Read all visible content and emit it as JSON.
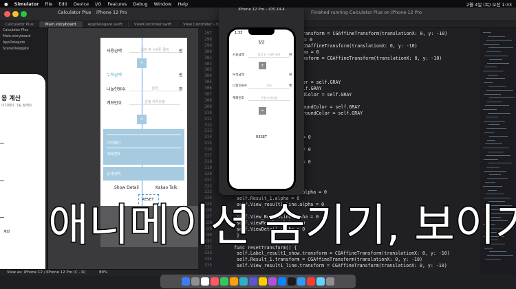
{
  "menubar": {
    "apple": "",
    "app": "Simulator",
    "items": [
      "File",
      "Edit",
      "Device",
      "I/O",
      "Features",
      "Debug",
      "Window",
      "Help"
    ],
    "status": "2월 4일 (목) 오전 1:33"
  },
  "xcode": {
    "scheme": "Calculator Plus",
    "device": "iPhone 12 Pro",
    "status": "Finished running Calculator Plus on iPhone 12 Pro",
    "tabs": [
      "Calculator Plus",
      "Main.storyboard",
      "AppDelegate.swift",
      "ViewController.swift"
    ],
    "breadcrumb": "View Controller › View › Button-RESET",
    "view_as": "View as: iPhone 12 / iPhone 12 Pro (C - R)",
    "zoom": "89%"
  },
  "navigator": {
    "rows": [
      "Calculator Plus",
      "Main.storyboard",
      "AppDelegate",
      "SceneDelegate"
    ],
    "sim_title": "용 계산",
    "sim_sub": "더치페이 그림 팔레트",
    "sim_labels": [
      "",
      "",
      "계좌"
    ]
  },
  "storyboard": {
    "labels": [
      "사용금액",
      "누적금액",
      "나눌인원수",
      "계좌번호"
    ],
    "fields": [
      "입력 후 +버튼 클릭",
      "",
      "입력",
      "은행 카카오뱅"
    ],
    "units": [
      "원",
      "원",
      "명",
      ""
    ],
    "tile_top": "+",
    "tile_mid": "=",
    "panel1": [
      "더치페이",
      "계좌번호"
    ],
    "panel2": "상세내역",
    "buttons": [
      "Show Detail",
      "Kakao Talk",
      "RESET"
    ]
  },
  "simulator": {
    "title": "iPhone 12 Pro – iOS 14.4",
    "time": "1:33",
    "nav_title": "일반",
    "labels": [
      "사용금액",
      "누적금액",
      "나눌인원수",
      "계좌번호"
    ],
    "fields": [
      "입력 후 +버튼 클릭",
      "",
      "입력",
      "은행 카카오뱅"
    ],
    "units": [
      "원",
      "원",
      "명",
      ""
    ],
    "tile_top": "+",
    "tile_mid": "=",
    "reset": "RESET"
  },
  "editor": {
    "line_numbers": [
      "297",
      "298",
      "299",
      "300",
      "301",
      "302",
      "303",
      "304",
      "305",
      "306",
      "307",
      "308",
      "309",
      "310",
      "311",
      "312",
      "313",
      "314",
      "315",
      "316",
      "317",
      "318",
      "319",
      "320",
      "321",
      "322",
      "323",
      "324",
      "325",
      "326",
      "327",
      "328",
      "329",
      "330",
      "331",
      "332",
      "333",
      "334",
      "335"
    ],
    "lines": [
      {
        "n": "297",
        "t": "show.transform = CGAffineTransform(translationX: 0, y: -10)"
      },
      {
        "n": "298",
        "t": "= 0"
      },
      {
        "n": "299",
        "t": "orm = CGAffineTransform(translationX: 0, y: -10)"
      },
      {
        "n": "300",
        "t": "ne.alpha = 0"
      },
      {
        "n": "301",
        "t": "ne.transform = CGAffineTransform(translationX: 0, y: -10)"
      },
      {
        "n": "305",
        "t": "extColor = self.GRAY"
      },
      {
        "n": "306",
        "t": "r = self.GRAY"
      },
      {
        "n": "307",
        "t": "kgroundColor = self.GRAY"
      },
      {
        "n": "309",
        "t": "backgroundColor = self.GRAY"
      },
      {
        "n": "310",
        "t": ".backgroundColor = self.GRAY"
      },
      {
        "n": "314",
        "t": "alpha = 0"
      },
      {
        "n": "316",
        "t": "alpha = 0"
      },
      {
        "n": "318",
        "t": "alpha = 0"
      },
      {
        "n": "320",
        "t": "alpha = 0"
      },
      {
        "n": "323",
        "t": "self.Label_result1_show.alpha = 0"
      },
      {
        "n": "324",
        "t": "self.Result_1.alpha = 0"
      },
      {
        "n": "325",
        "t": "self.View_result1_line.alpha = 0"
      },
      {
        "n": "327",
        "t": "self.View_ButtonLine.alpha = 0"
      },
      {
        "n": "328",
        "t": "self.viewResult.alpha = 0"
      },
      {
        "n": "329",
        "t": "self.ViewDetail.alpha = 0"
      },
      {
        "n": "330",
        "t": "}"
      },
      {
        "n": "332",
        "t": "func resetTransform() {"
      },
      {
        "n": "333",
        "t": "self.Label_result1_show.transform = CGAffineTransform(translationX: 0, y: -10)"
      },
      {
        "n": "334",
        "t": "self.Result_1.transform = CGAffineTransform(translationX: 0, y: -10)"
      },
      {
        "n": "335",
        "t": "self.View_result1_line.transform = CGAffineTransform(translationX: 0, y: -10)"
      }
    ]
  },
  "caption": "애니메이션 숨기기, 보이기",
  "dock_colors": [
    "#3d7cf5",
    "#8e8e93",
    "#ffffff",
    "#ff5a5f",
    "#34c759",
    "#ff9f0a",
    "#30b0c7",
    "#5856d6",
    "#ffcc00",
    "#af52de",
    "#0a84ff",
    "#1c1c1e",
    "#2f9bf5",
    "#ff3b30",
    "#64d2ff",
    "#8e8e93"
  ]
}
